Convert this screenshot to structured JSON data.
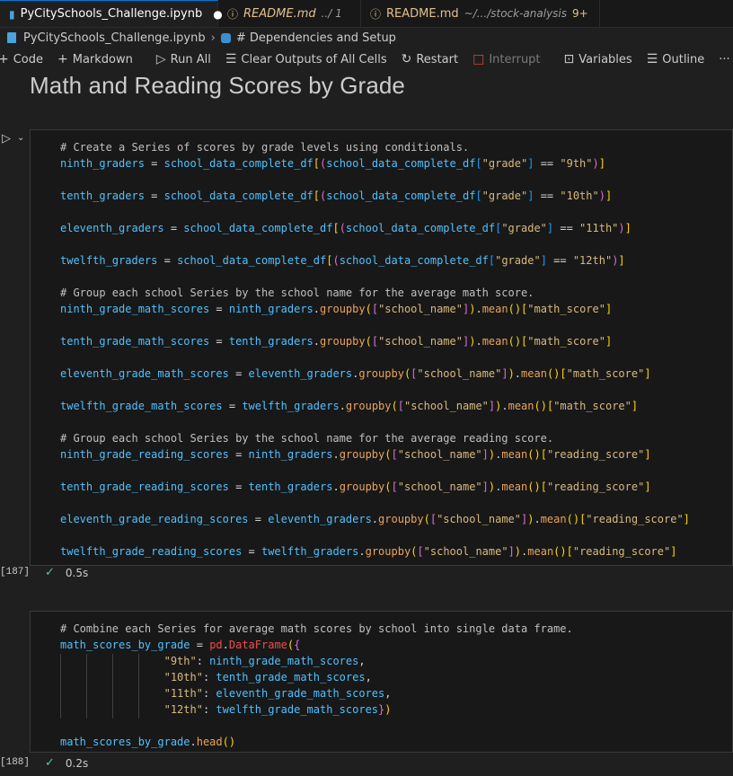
{
  "tabs": [
    {
      "label": "PyCitySchools_Challenge.ipynb",
      "modified_dot": "●",
      "active": true
    },
    {
      "label": "README.md",
      "sub": "../ 1",
      "active": false
    },
    {
      "label": "README.md",
      "sub": "~/.../stock-analysis",
      "badge": "9+",
      "active": false
    }
  ],
  "breadcrumb": {
    "file": "PyCitySchools_Challenge.ipynb",
    "section": "# Dependencies and Setup"
  },
  "toolbar": {
    "code": "Code",
    "markdown": "Markdown",
    "run_all": "Run All",
    "clear": "Clear Outputs of All Cells",
    "restart": "Restart",
    "interrupt": "Interrupt",
    "variables": "Variables",
    "outline": "Outline",
    "more": "···"
  },
  "heading": "Math and Reading Scores by Grade",
  "cell1": {
    "exec_count": "[187]",
    "duration": "0.5s",
    "comment1": "# Create a Series of scores by grade levels using conditionals.",
    "comment2": "# Group each school Series by the school name for the average math score.",
    "comment3": "# Group each school Series by the school name for the average reading score.",
    "df": "school_data_complete_df",
    "graders": [
      "ninth_graders",
      "tenth_graders",
      "eleventh_graders",
      "twelfth_graders"
    ],
    "grades": [
      "\"9th\"",
      "\"10th\"",
      "\"11th\"",
      "\"12th\""
    ],
    "math_vars": [
      "ninth_grade_math_scores",
      "tenth_grade_math_scores",
      "eleventh_grade_math_scores",
      "twelfth_grade_math_scores"
    ],
    "reading_vars": [
      "ninth_grade_reading_scores",
      "tenth_grade_reading_scores",
      "eleventh_grade_reading_scores",
      "twelfth_grade_reading_scores"
    ],
    "grade_key": "\"grade\"",
    "school_key": "\"school_name\"",
    "math_key": "\"math_score\"",
    "reading_key": "\"reading_score\""
  },
  "cell2": {
    "exec_count": "[188]",
    "duration": "0.2s",
    "comment": "# Combine each Series for average math scores by school into single data frame.",
    "var": "math_scores_by_grade",
    "pd": "pd",
    "ctor": "DataFrame",
    "keys": [
      "\"9th\"",
      "\"10th\"",
      "\"11th\"",
      "\"12th\""
    ],
    "values": [
      "ninth_grade_math_scores",
      "tenth_grade_math_scores",
      "eleventh_grade_math_scores",
      "twelfth_grade_math_scores"
    ],
    "head_call": "head"
  }
}
